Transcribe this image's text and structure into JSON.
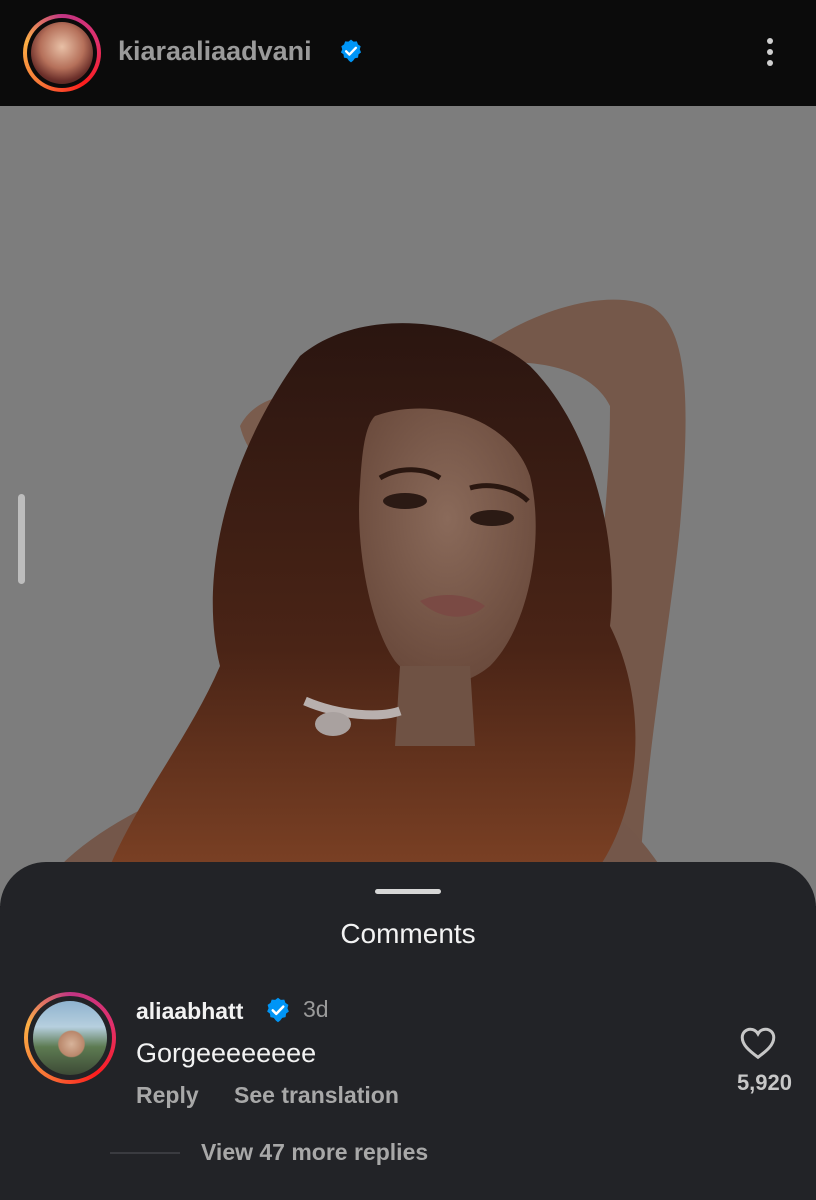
{
  "post": {
    "username": "kiaraaliaadvani",
    "verified": true,
    "more_icon": "more-vertical-icon"
  },
  "comments_sheet": {
    "title": "Comments",
    "comments": [
      {
        "username": "aliaabhatt",
        "verified": true,
        "time": "3d",
        "text": "Gorgeeeeeeee",
        "reply_label": "Reply",
        "translate_label": "See translation",
        "likes": "5,920",
        "view_replies": "View 47 more replies"
      }
    ]
  },
  "colors": {
    "verified_blue": "#0095f6",
    "sheet_bg": "#222327",
    "photo_bg": "#7d7d7d"
  }
}
